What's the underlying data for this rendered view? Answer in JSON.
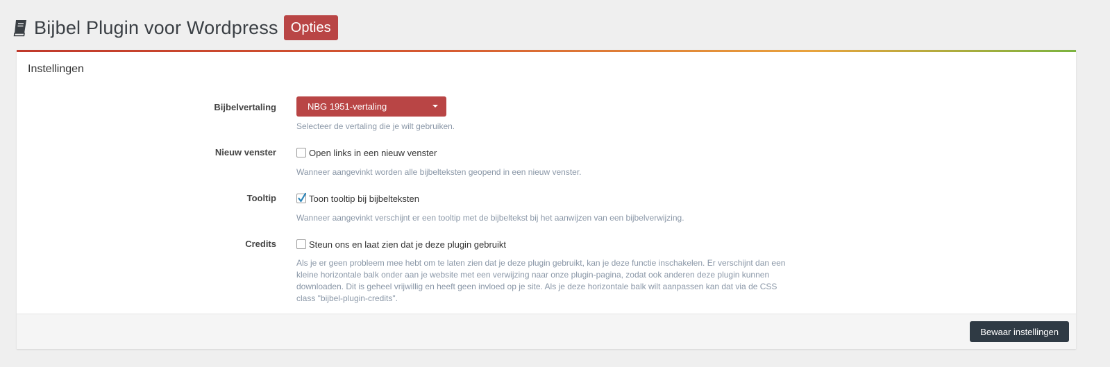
{
  "header": {
    "title": "Bijbel Plugin voor Wordpress",
    "badge": "Opties",
    "icon": "book-icon"
  },
  "colors": {
    "brand_red": "#b94545",
    "dark_button": "#2f3a44",
    "help_text": "#8a97a7",
    "accent_gradient": [
      "#c0392b",
      "#e8a33d",
      "#7bb33f"
    ]
  },
  "panel": {
    "heading": "Instellingen",
    "fields": {
      "translation": {
        "label": "Bijbelvertaling",
        "selected": "NBG 1951-vertaling",
        "help": "Selecteer de vertaling die je wilt gebruiken."
      },
      "new_window": {
        "label": "Nieuw venster",
        "checkbox_label": "Open links in een nieuw venster",
        "checked": false,
        "help": "Wanneer aangevinkt worden alle bijbelteksten geopend in een nieuw venster."
      },
      "tooltip": {
        "label": "Tooltip",
        "checkbox_label": "Toon tooltip bij bijbelteksten",
        "checked": true,
        "help": "Wanneer aangevinkt verschijnt er een tooltip met de bijbeltekst bij het aanwijzen van een bijbelverwijzing."
      },
      "credits": {
        "label": "Credits",
        "checkbox_label": "Steun ons en laat zien dat je deze plugin gebruikt",
        "checked": false,
        "help": "Als je er geen probleem mee hebt om te laten zien dat je deze plugin gebruikt, kan je deze functie inschakelen. Er verschijnt dan een kleine horizontale balk onder aan je website met een verwijzing naar onze plugin-pagina, zodat ook anderen deze plugin kunnen downloaden. Dit is geheel vrijwillig en heeft geen invloed op je site. Als je deze horizontale balk wilt aanpassen kan dat via de CSS class \"bijbel-plugin-credits\"."
      }
    },
    "footer": {
      "save_label": "Bewaar instellingen"
    }
  }
}
